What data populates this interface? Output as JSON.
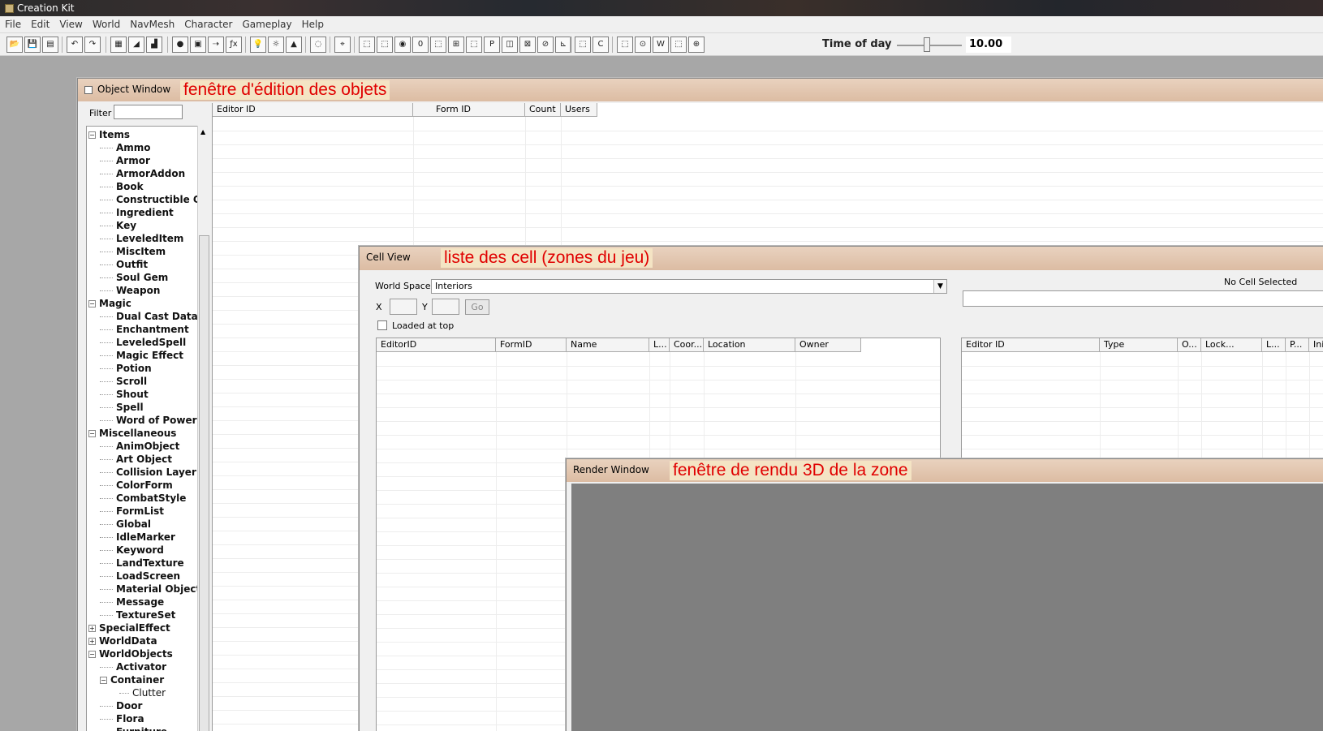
{
  "app_title": "Creation Kit",
  "menu": [
    "File",
    "Edit",
    "View",
    "World",
    "NavMesh",
    "Character",
    "Gameplay",
    "Help"
  ],
  "toolbar": {
    "time_of_day_label": "Time of day",
    "time_of_day_value": "10.00",
    "glyphs": [
      "📂",
      "💾",
      "▤",
      "↶",
      "↷",
      "▦",
      "◢",
      "▟",
      "●",
      "▣",
      "⇢",
      "ƒx",
      "💡",
      "☼",
      "▲",
      "◌",
      "⌖",
      "⬚",
      "⬚",
      "◉",
      "0",
      "⬚",
      "⊞",
      "⬚",
      "P",
      "◫",
      "⊠",
      "⊘",
      "⊾",
      "⬚",
      "C",
      "⬚",
      "⊙",
      "W",
      "⬚",
      "⊕"
    ]
  },
  "object_window": {
    "title": "Object Window",
    "annotation": "fenêtre d'édition des objets",
    "filter_label": "Filter",
    "columns": [
      "Editor ID",
      "Form ID",
      "Count",
      "Users"
    ],
    "tree": [
      {
        "label": "Items",
        "level": 0,
        "exp": "−"
      },
      {
        "label": "Ammo",
        "level": 1
      },
      {
        "label": "Armor",
        "level": 1
      },
      {
        "label": "ArmorAddon",
        "level": 1
      },
      {
        "label": "Book",
        "level": 1
      },
      {
        "label": "Constructible Ob",
        "level": 1
      },
      {
        "label": "Ingredient",
        "level": 1
      },
      {
        "label": "Key",
        "level": 1
      },
      {
        "label": "LeveledItem",
        "level": 1
      },
      {
        "label": "MiscItem",
        "level": 1
      },
      {
        "label": "Outfit",
        "level": 1
      },
      {
        "label": "Soul Gem",
        "level": 1
      },
      {
        "label": "Weapon",
        "level": 1
      },
      {
        "label": "Magic",
        "level": 0,
        "exp": "−"
      },
      {
        "label": "Dual Cast Data",
        "level": 1
      },
      {
        "label": "Enchantment",
        "level": 1
      },
      {
        "label": "LeveledSpell",
        "level": 1
      },
      {
        "label": "Magic Effect",
        "level": 1
      },
      {
        "label": "Potion",
        "level": 1
      },
      {
        "label": "Scroll",
        "level": 1
      },
      {
        "label": "Shout",
        "level": 1
      },
      {
        "label": "Spell",
        "level": 1
      },
      {
        "label": "Word of Power",
        "level": 1
      },
      {
        "label": "Miscellaneous",
        "level": 0,
        "exp": "−"
      },
      {
        "label": "AnimObject",
        "level": 1
      },
      {
        "label": "Art Object",
        "level": 1
      },
      {
        "label": "Collision Layer",
        "level": 1
      },
      {
        "label": "ColorForm",
        "level": 1
      },
      {
        "label": "CombatStyle",
        "level": 1
      },
      {
        "label": "FormList",
        "level": 1
      },
      {
        "label": "Global",
        "level": 1
      },
      {
        "label": "IdleMarker",
        "level": 1
      },
      {
        "label": "Keyword",
        "level": 1
      },
      {
        "label": "LandTexture",
        "level": 1
      },
      {
        "label": "LoadScreen",
        "level": 1
      },
      {
        "label": "Material Object",
        "level": 1
      },
      {
        "label": "Message",
        "level": 1
      },
      {
        "label": "TextureSet",
        "level": 1
      },
      {
        "label": "SpecialEffect",
        "level": 0,
        "exp": "+"
      },
      {
        "label": "WorldData",
        "level": 0,
        "exp": "+"
      },
      {
        "label": "WorldObjects",
        "level": 0,
        "exp": "−"
      },
      {
        "label": "Activator",
        "level": 1
      },
      {
        "label": "Container",
        "level": 1,
        "exp": "−"
      },
      {
        "label": "Clutter",
        "level": 2
      },
      {
        "label": "Door",
        "level": 1
      },
      {
        "label": "Flora",
        "level": 1
      },
      {
        "label": "Furniture",
        "level": 1
      }
    ]
  },
  "cell_view": {
    "title": "Cell View",
    "annotation": "liste des cell (zones du jeu)",
    "world_space_label": "World Space",
    "world_space_value": "Interiors",
    "x_label": "X",
    "y_label": "Y",
    "go_label": "Go",
    "loaded_at_top_label": "Loaded at top",
    "no_cell_selected": "No Cell Selected",
    "left_columns": [
      "EditorID",
      "FormID",
      "Name",
      "L...",
      "Coor...",
      "Location",
      "Owner"
    ],
    "right_columns": [
      "Editor ID",
      "Type",
      "O...",
      "Lock...",
      "L...",
      "P...",
      "Initiall"
    ]
  },
  "render_window": {
    "title": "Render Window",
    "annotation": "fenêtre de rendu 3D de la zone"
  }
}
